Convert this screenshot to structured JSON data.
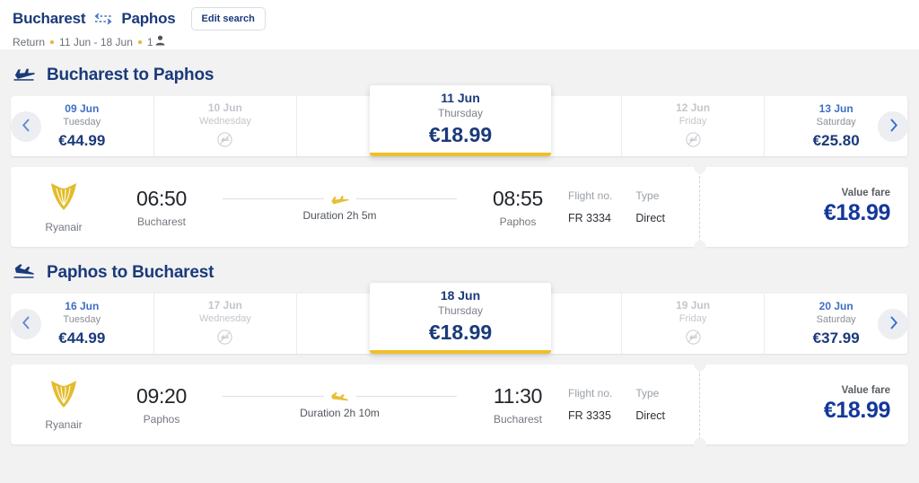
{
  "header": {
    "origin": "Bucharest",
    "destination": "Paphos",
    "swap_icon": "swap-horizontal-icon",
    "edit_search_label": "Edit search",
    "trip_type": "Return",
    "date_range": "11 Jun - 18 Jun",
    "passengers": "1",
    "passenger_icon": "person-icon"
  },
  "outbound": {
    "section_title": "Bucharest to Paphos",
    "section_icon": "plane-takeoff-icon",
    "prev_label": "‹",
    "next_label": "›",
    "dates": [
      {
        "day": "09 Jun",
        "weekday": "Tuesday",
        "price": "€44.99",
        "available": true,
        "selected": false
      },
      {
        "day": "10 Jun",
        "weekday": "Wednesday",
        "price": "",
        "available": false,
        "selected": false
      },
      {
        "day": "11 Jun",
        "weekday": "Thursday",
        "price": "€18.99",
        "available": true,
        "selected": true
      },
      {
        "day": "12 Jun",
        "weekday": "Friday",
        "price": "",
        "available": false,
        "selected": false
      },
      {
        "day": "13 Jun",
        "weekday": "Saturday",
        "price": "€25.80",
        "available": true,
        "selected": false
      }
    ],
    "flight": {
      "airline": "Ryanair",
      "airline_logo": "ryanair-harp-logo",
      "depart_time": "06:50",
      "depart_airport": "Bucharest",
      "duration": "Duration 2h 5m",
      "duration_icon": "plane-takeoff-icon",
      "arrive_time": "08:55",
      "arrive_airport": "Paphos",
      "flight_no_label": "Flight no.",
      "flight_no": "FR 3334",
      "type_label": "Type",
      "type_value": "Direct",
      "fare_label": "Value fare",
      "fare_price": "€18.99"
    }
  },
  "inbound": {
    "section_title": "Paphos to Bucharest",
    "section_icon": "plane-landing-icon",
    "prev_label": "‹",
    "next_label": "›",
    "dates": [
      {
        "day": "16 Jun",
        "weekday": "Tuesday",
        "price": "€44.99",
        "available": true,
        "selected": false
      },
      {
        "day": "17 Jun",
        "weekday": "Wednesday",
        "price": "",
        "available": false,
        "selected": false
      },
      {
        "day": "18 Jun",
        "weekday": "Thursday",
        "price": "€18.99",
        "available": true,
        "selected": true
      },
      {
        "day": "19 Jun",
        "weekday": "Friday",
        "price": "",
        "available": false,
        "selected": false
      },
      {
        "day": "20 Jun",
        "weekday": "Saturday",
        "price": "€37.99",
        "available": true,
        "selected": false
      }
    ],
    "flight": {
      "airline": "Ryanair",
      "airline_logo": "ryanair-harp-logo",
      "depart_time": "09:20",
      "depart_airport": "Paphos",
      "duration": "Duration 2h 10m",
      "duration_icon": "plane-landing-icon",
      "arrive_time": "11:30",
      "arrive_airport": "Bucharest",
      "flight_no_label": "Flight no.",
      "flight_no": "FR 3335",
      "type_label": "Type",
      "type_value": "Direct",
      "fare_label": "Value fare",
      "fare_price": "€18.99"
    }
  },
  "colors": {
    "navy": "#1a3a7a",
    "blue": "#13379b",
    "gold": "#f0c02b",
    "ryanair_gold": "#e3bc2d",
    "page_bg": "#f2f2f2"
  }
}
